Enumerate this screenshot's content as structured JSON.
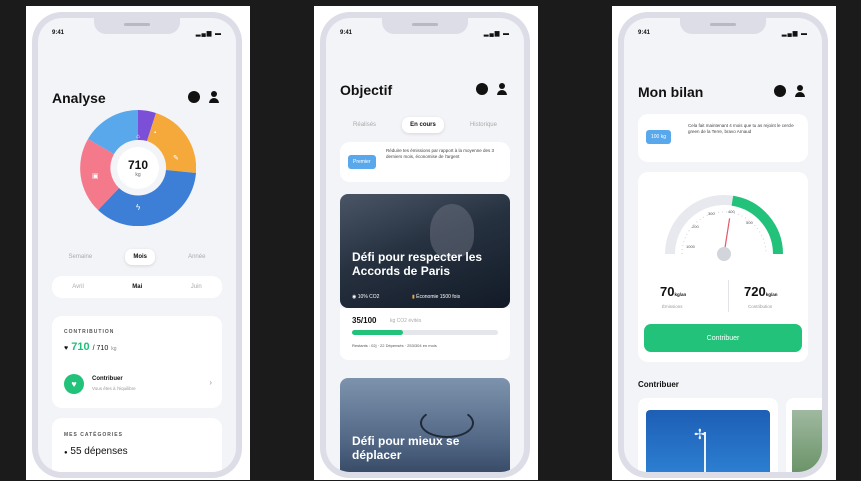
{
  "screens": [
    {
      "time": "9:41",
      "title": "Analyse",
      "donut": {
        "value": "710",
        "unit": "kg"
      },
      "period_tabs": [
        "Semaine",
        "Mois",
        "Année"
      ],
      "period_selected": 1,
      "month_tabs": [
        "Avril",
        "Mai",
        "Juin"
      ],
      "month_selected": 1,
      "contribution": {
        "label": "CONTRIBUTION",
        "value": "710",
        "total": "/ 710",
        "unit": "kg",
        "action_title": "Contribuer",
        "action_sub": "Vous êtes à l'équilibre"
      },
      "categories": {
        "label": "MES CATÉGORIES",
        "count": "55 dépenses"
      }
    },
    {
      "time": "9:41",
      "title": "Objectif",
      "tabs": [
        "Réalisés",
        "En cours",
        "Historique"
      ],
      "tab_selected": 1,
      "promo": {
        "chip": "Premier",
        "text": "Réduire tes émissions par rapport à la moyenne des 3 derniers mois, économise de l'argent"
      },
      "challenge1": {
        "title": "Défi pour respecter les Accords de Paris",
        "meta1": "10% CO2",
        "meta2": "Économie 1500 fois",
        "progress_value": "35/100",
        "progress_unit": "kg CO2 évités",
        "progress": 0.35,
        "foot": "Restants : 02j · 22 Dépensés · 253/304 en mois"
      },
      "challenge2": {
        "title": "Défi pour mieux se déplacer"
      }
    },
    {
      "time": "9:41",
      "title": "Mon bilan",
      "promo": {
        "chip": "100 kg",
        "text": "Cela fait maintenant 4 mois que tu as rejoint le cercle green de la Terre, bravo Arnaud"
      },
      "gauge": {
        "ticks": [
          "200",
          "300",
          "400",
          "500",
          "1000"
        ],
        "level": 0.55
      },
      "stats": [
        {
          "value": "70",
          "unit": "kg/an",
          "label": "Émissions"
        },
        {
          "value": "720",
          "unit": "kg/an",
          "label": "Contribution"
        }
      ],
      "button": "Contribuer",
      "section": "Contribuer"
    }
  ],
  "colors": {
    "green": "#22c27a",
    "blue": "#3d7fd6",
    "orange": "#f6a93b",
    "pink": "#f47a8b",
    "purple": "#7b4fd6",
    "light_blue": "#5aa8ec"
  }
}
